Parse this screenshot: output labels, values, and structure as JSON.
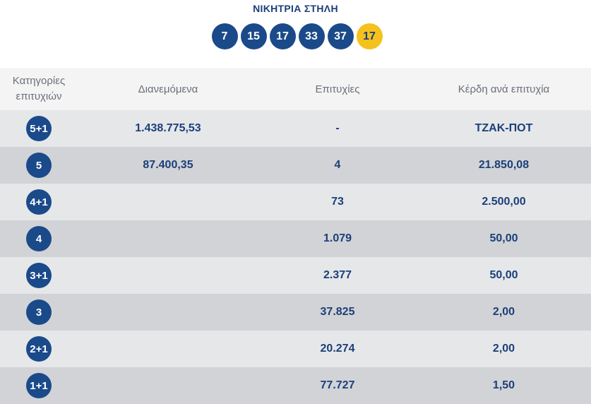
{
  "title": "ΝΙΚΗΤΡΙΑ ΣΤΗΛΗ",
  "numbers": [
    "7",
    "15",
    "17",
    "33",
    "37"
  ],
  "joker": "17",
  "headers": {
    "category_line1": "Κατηγορίες",
    "category_line2": "επιτυχιών",
    "distributed": "Διανεμόμενα",
    "winners": "Επιτυχίες",
    "prize": "Κέρδη ανά επιτυχία"
  },
  "rows": [
    {
      "category": "5+1",
      "distributed": "1.438.775,53",
      "winners": "-",
      "prize": "ΤΖΑΚ-ΠΟΤ"
    },
    {
      "category": "5",
      "distributed": "87.400,35",
      "winners": "4",
      "prize": "21.850,08"
    },
    {
      "category": "4+1",
      "distributed": "",
      "winners": "73",
      "prize": "2.500,00"
    },
    {
      "category": "4",
      "distributed": "",
      "winners": "1.079",
      "prize": "50,00"
    },
    {
      "category": "3+1",
      "distributed": "",
      "winners": "2.377",
      "prize": "50,00"
    },
    {
      "category": "3",
      "distributed": "",
      "winners": "37.825",
      "prize": "2,00"
    },
    {
      "category": "2+1",
      "distributed": "",
      "winners": "20.274",
      "prize": "2,00"
    },
    {
      "category": "1+1",
      "distributed": "",
      "winners": "77.727",
      "prize": "1,50"
    }
  ],
  "colors": {
    "ball": "#1b4a8a",
    "joker_ball": "#f5c11c",
    "text": "#1b3f7a"
  }
}
